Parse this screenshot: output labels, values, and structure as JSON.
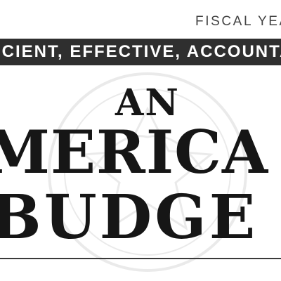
{
  "header": {
    "fiscal_year_label": "FISCAL YEA"
  },
  "banner": {
    "text": "ICIENT, EFFECTIVE, ACCOUNTA",
    "background_color": "#2f2f2f",
    "text_color": "#ffffff"
  },
  "title": {
    "line1": "AN",
    "line2": "MERICA",
    "line3": "BUDGE",
    "color": "#161616"
  },
  "icons": {
    "watermark": "seal-watermark-icon"
  }
}
